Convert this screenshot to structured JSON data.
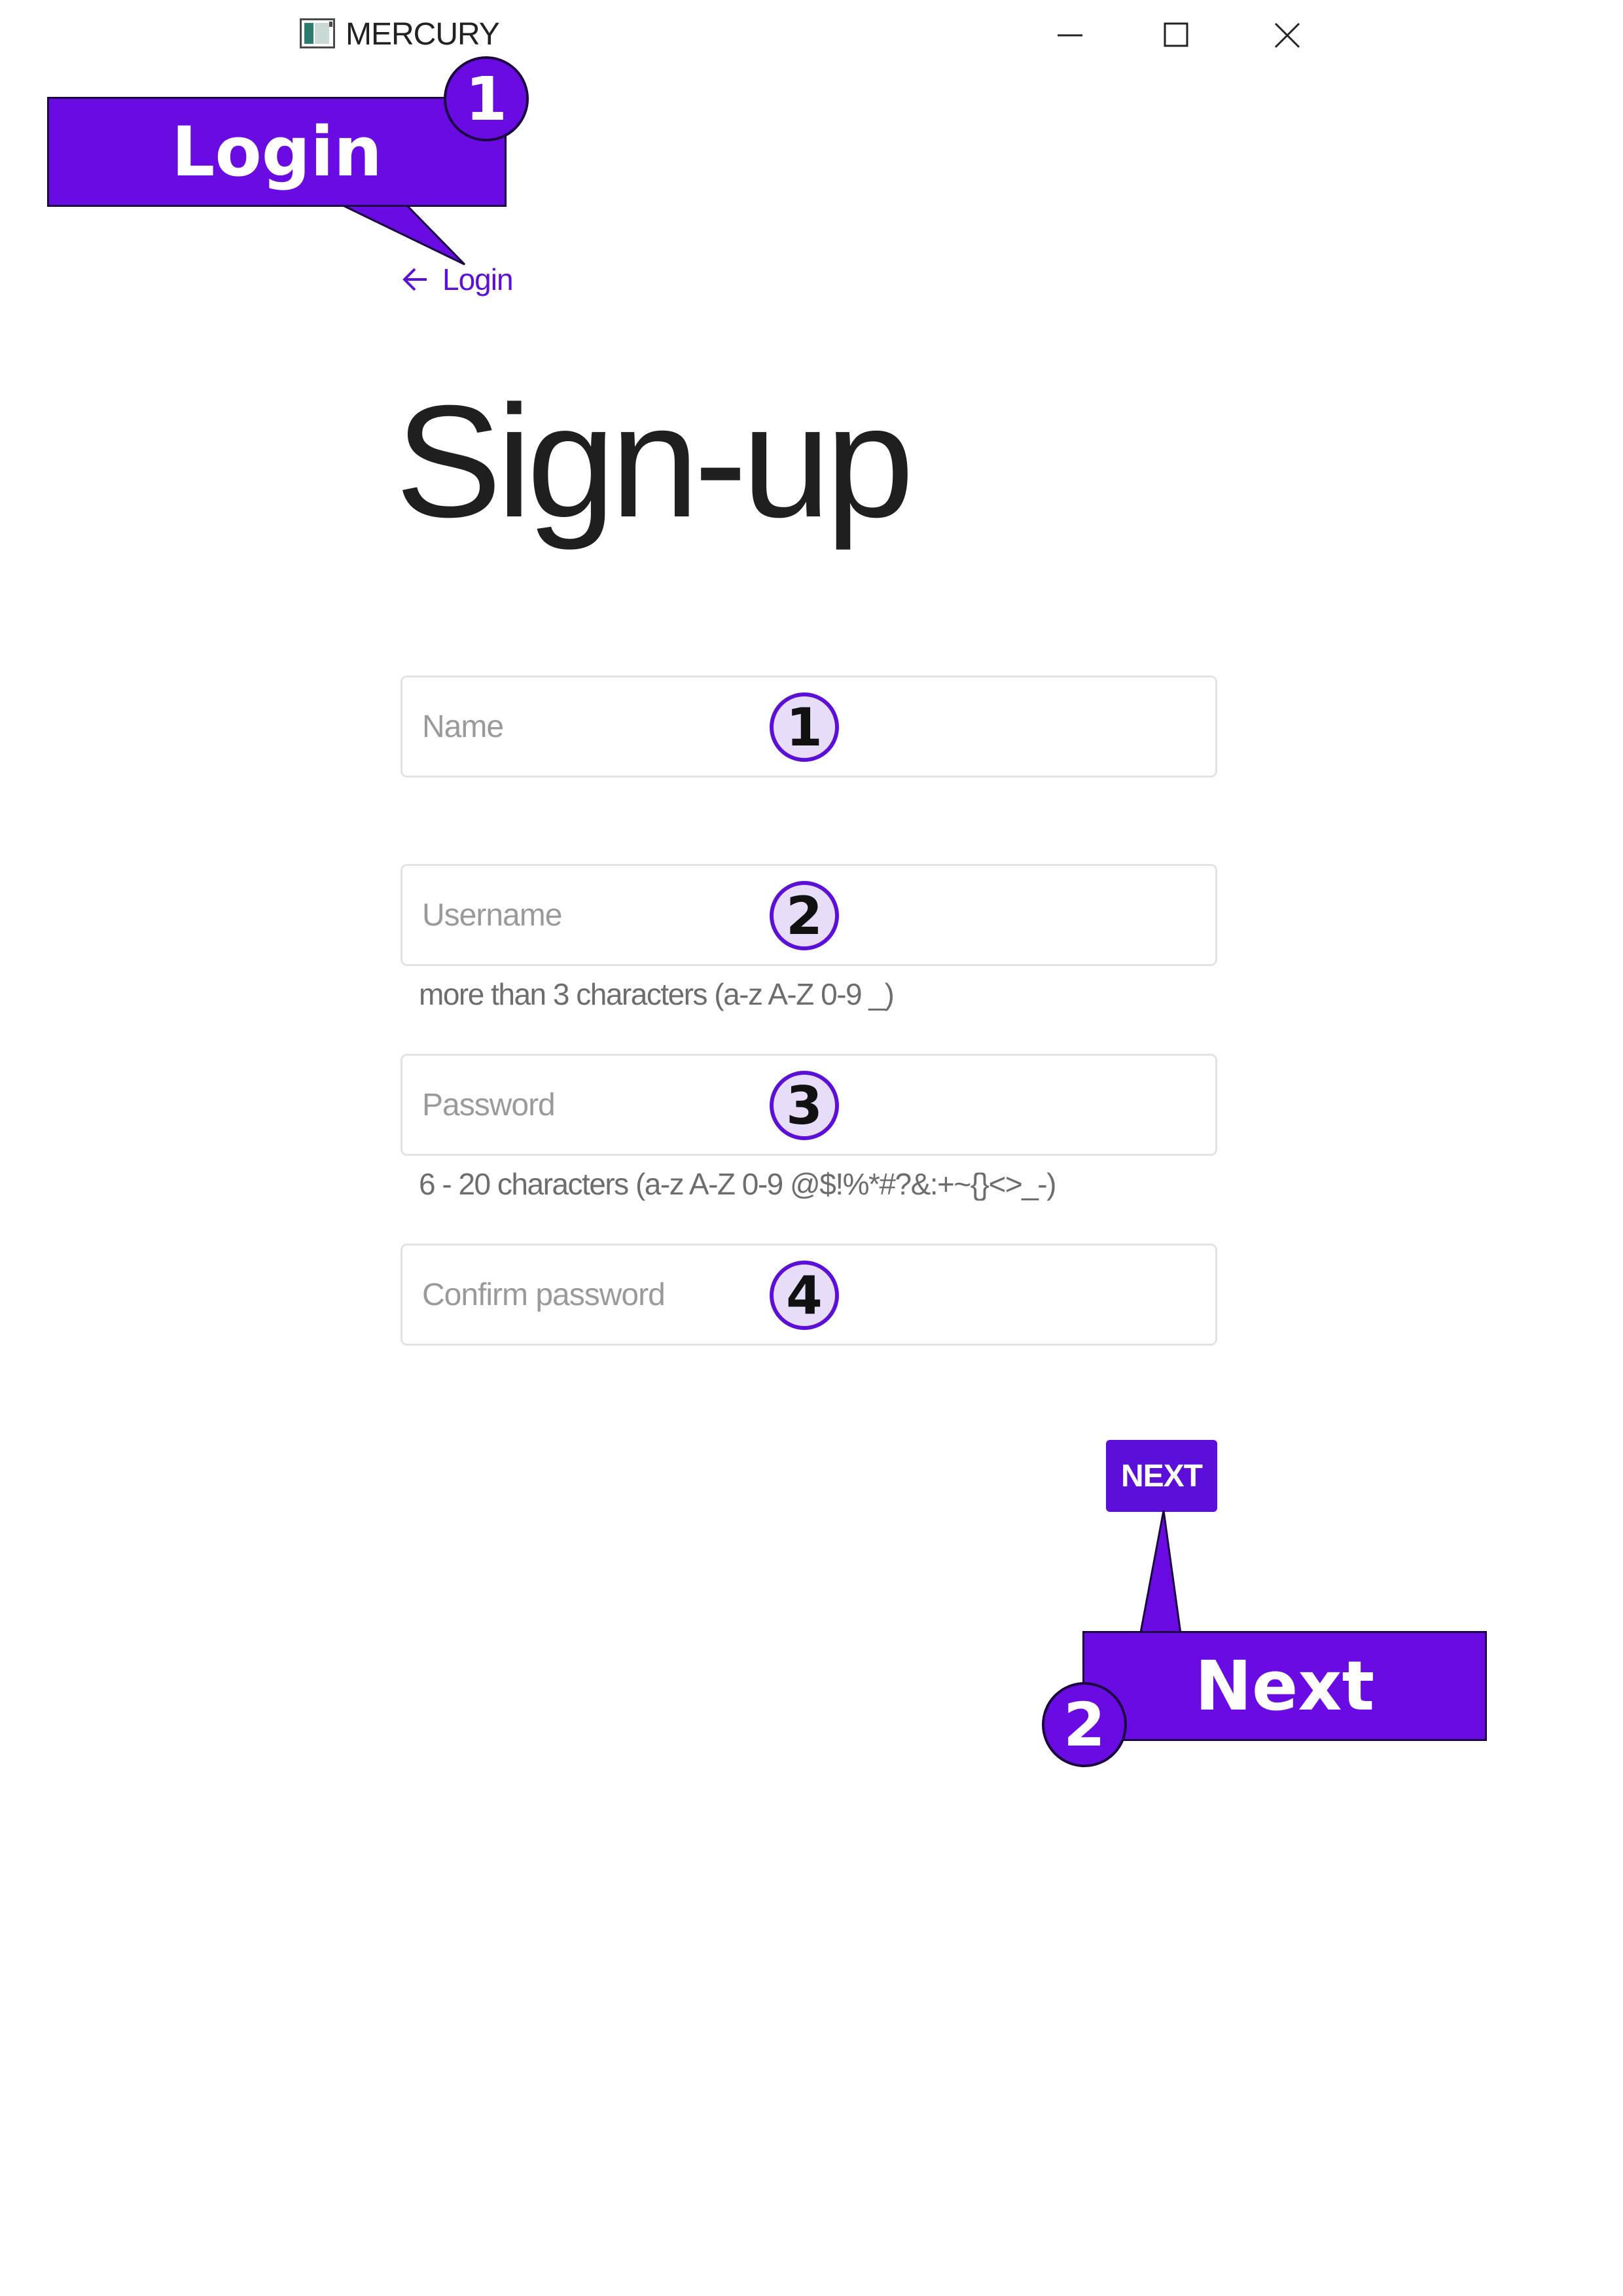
{
  "window": {
    "title": "MERCURY",
    "app_icon": "window-app-icon",
    "controls": {
      "minimize_icon": "minimize-icon",
      "maximize_icon": "maximize-icon",
      "close_icon": "close-icon"
    }
  },
  "back_link": {
    "icon": "arrow-left-icon",
    "label": "Login"
  },
  "page_title": "Sign-up",
  "fields": [
    {
      "placeholder": "Name",
      "value": "",
      "badge": "1",
      "hint": ""
    },
    {
      "placeholder": "Username",
      "value": "",
      "badge": "2",
      "hint": "more than 3 characters (a-z A-Z 0-9 _)"
    },
    {
      "placeholder": "Password",
      "value": "",
      "badge": "3",
      "hint": "6 - 20 characters (a-z A-Z 0-9  @$!%*#?&:+~{}<>_-)"
    },
    {
      "placeholder": "Confirm password",
      "value": "",
      "badge": "4",
      "hint": ""
    }
  ],
  "next_button": {
    "label": "NEXT"
  },
  "callouts": [
    {
      "badge": "1",
      "label": "Login"
    },
    {
      "badge": "2",
      "label": "Next"
    }
  ],
  "colors": {
    "accent": "#5c0fd9",
    "callout": "#6a0be4",
    "badge_fill": "#e7ddf8",
    "field_border": "#e3e3e3",
    "placeholder": "#9a9a9a"
  }
}
